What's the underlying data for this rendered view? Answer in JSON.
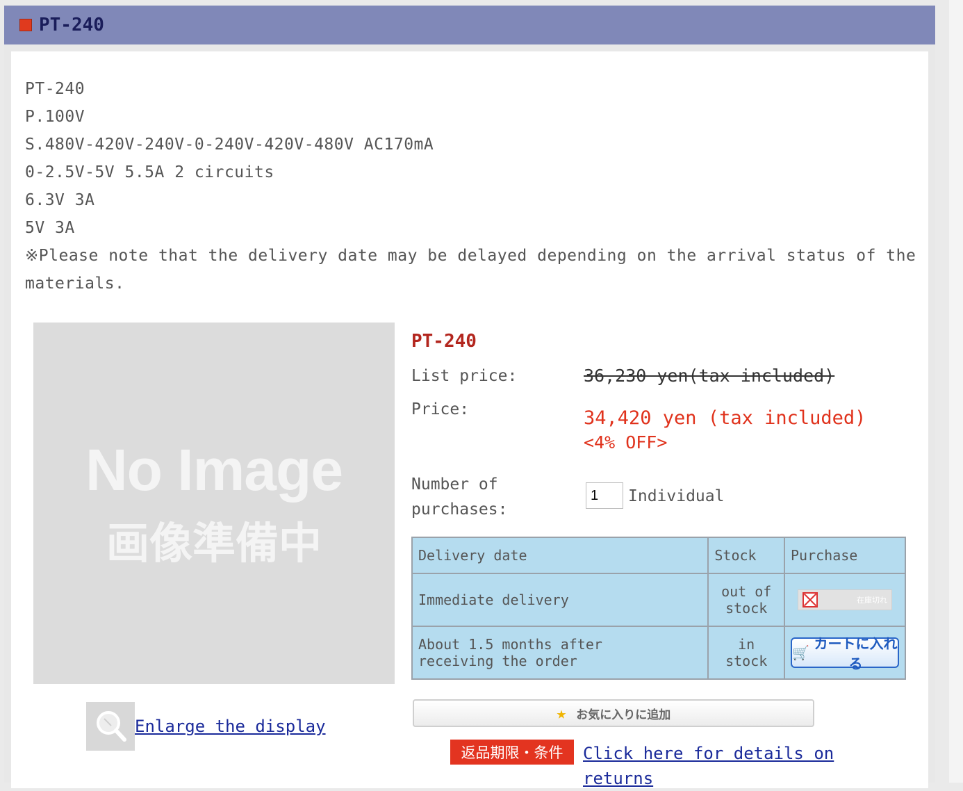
{
  "header": {
    "title": "PT-240"
  },
  "description": {
    "lines": [
      "PT-240",
      "P.100V",
      "S.480V-420V-240V-0-240V-420V-480V AC170mA",
      "0-2.5V-5V 5.5A 2 circuits",
      "6.3V 3A",
      "5V 3A",
      "※Please note that the delivery date may be delayed depending on the arrival status of the materials."
    ]
  },
  "image": {
    "no_image_text": "No Image",
    "preparing_text": "画像準備中"
  },
  "enlarge": {
    "label": "Enlarge the display"
  },
  "product": {
    "name": "PT-240",
    "list_price_label": "List price:",
    "list_price_value": "36,230 yen(tax included)",
    "price_label": "Price:",
    "price_value": "34,420 yen (tax included)",
    "discount": "<4% OFF>",
    "qty_label_1": "Number of",
    "qty_label_2": "purchases:",
    "qty_value": "1",
    "qty_unit": "Individual"
  },
  "stock_table": {
    "headers": [
      "Delivery date",
      "Stock",
      "Purchase"
    ],
    "rows": [
      {
        "delivery": "Immediate delivery",
        "stock_1": "out of",
        "stock_2": "stock",
        "purchase": "在庫切れ"
      },
      {
        "delivery_1": "About 1.5 months after",
        "delivery_2": "receiving the order",
        "stock_1": "in",
        "stock_2": "stock",
        "purchase": "カートに入れる"
      }
    ]
  },
  "favorite": {
    "label": "お気に入りに追加"
  },
  "returns": {
    "badge": "返品期限・条件",
    "link": "Click here for details on returns"
  },
  "colors": {
    "header_bg": "#8088b8",
    "price_red": "#e0321c",
    "table_bg": "#b5dcef",
    "link_blue": "#1a2a9a"
  }
}
